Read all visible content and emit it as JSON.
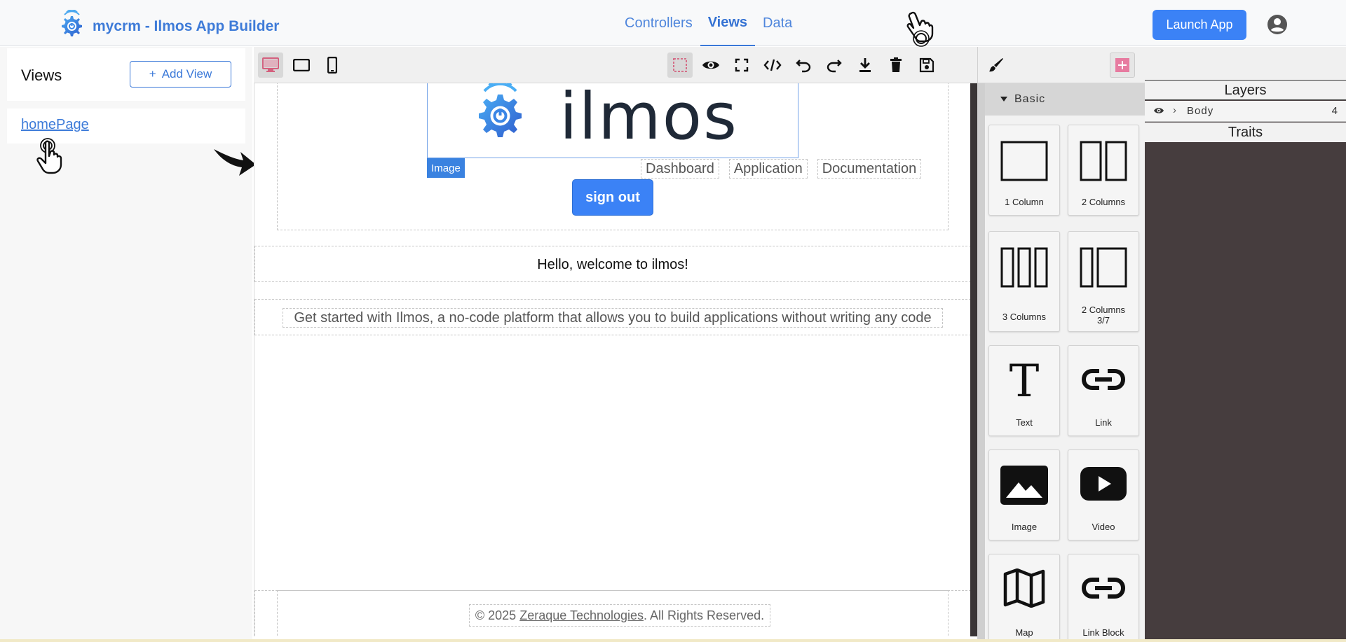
{
  "header": {
    "brand_title": "mycrm - Ilmos App Builder",
    "nav": [
      {
        "label": "Controllers",
        "active": false
      },
      {
        "label": "Views",
        "active": true
      },
      {
        "label": "Data",
        "active": false
      }
    ],
    "launch_label": "Launch App",
    "accent_color": "#3b82f6"
  },
  "left_panel": {
    "title": "Views",
    "add_view_label": "Add View",
    "add_view_icon": "+",
    "views": [
      {
        "label": "homePage"
      }
    ]
  },
  "toolbar": {
    "devices": [
      "desktop-icon",
      "tablet-icon",
      "mobile-icon"
    ],
    "commands": [
      "sw-visibility-icon",
      "preview-icon",
      "fullscreen-icon",
      "code-icon",
      "undo-icon",
      "redo-icon",
      "download-icon",
      "trash-icon",
      "save-icon"
    ]
  },
  "canvas": {
    "logo_text": "ilmos",
    "image_badge": "Image",
    "nav_links": [
      "Dashboard",
      "Application",
      "Documentation"
    ],
    "signout_label": "sign out",
    "hello_text": "Hello, welcome to ilmos!",
    "intro_text": "Get started with Ilmos, a no-code platform that allows you to build applications without writing any code",
    "footer": {
      "prefix": "© 2025",
      "link": "Zeraque Technologies",
      "suffix": ". All Rights Reserved."
    }
  },
  "blocks": {
    "category": "Basic",
    "items": [
      {
        "label": "1 Column",
        "icon": "one-column-icon"
      },
      {
        "label": "2 Columns",
        "icon": "two-columns-icon"
      },
      {
        "label": "3 Columns",
        "icon": "three-columns-icon"
      },
      {
        "label": "2 Columns 3/7",
        "icon": "two-columns-37-icon"
      },
      {
        "label": "Text",
        "icon": "text-icon"
      },
      {
        "label": "Link",
        "icon": "link-icon"
      },
      {
        "label": "Image",
        "icon": "image-icon"
      },
      {
        "label": "Video",
        "icon": "video-icon"
      },
      {
        "label": "Map",
        "icon": "map-icon"
      },
      {
        "label": "Link Block",
        "icon": "link-block-icon"
      }
    ]
  },
  "layers": {
    "title": "Layers",
    "items": [
      {
        "name": "Body",
        "count": "4"
      }
    ],
    "traits_title": "Traits"
  }
}
